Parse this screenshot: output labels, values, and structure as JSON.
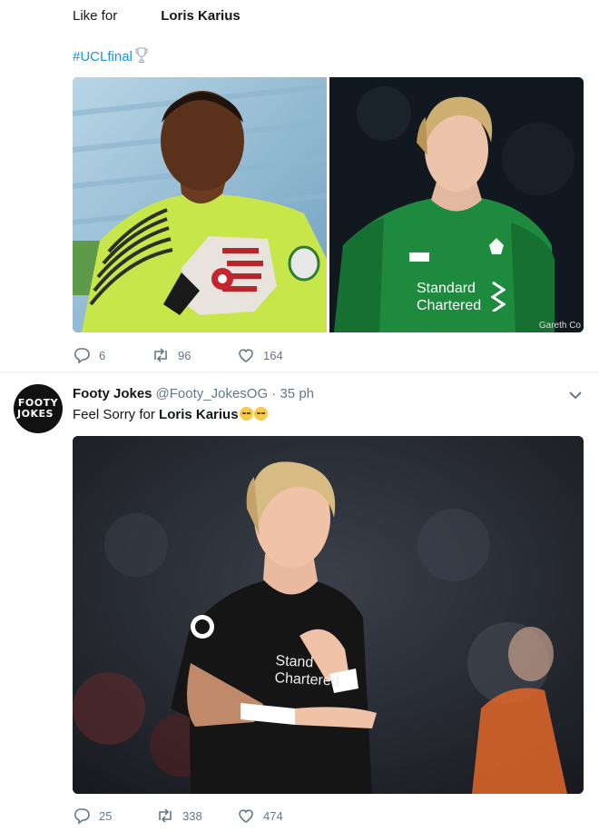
{
  "tweet1": {
    "text_prefix": "Like for",
    "text_name": "Loris Karius",
    "hashtag": "#UCLfinal",
    "media_left_label": "goalkeeper-green-jersey-photo",
    "media_right": {
      "sponsor_line1": "Standard",
      "sponsor_line2": "Chartered",
      "watermark": "Gareth Co"
    },
    "actions": {
      "replies": "6",
      "retweets": "96",
      "likes": "164"
    }
  },
  "tweet2": {
    "avatar_line1": "FOOTY",
    "avatar_line2": "JOKES",
    "display_name": "Footy Jokes",
    "handle": "@Footy_JokesOG · 35 ph",
    "text_prefix": "Feel Sorry for",
    "text_name": "Loris Karius",
    "media": {
      "sponsor_line1": "Stand",
      "sponsor_line2": "Chartered"
    },
    "actions": {
      "replies": "25",
      "retweets": "338",
      "likes": "474"
    }
  },
  "colors": {
    "link": "#1b95e0",
    "muted": "#657786",
    "text": "#14171a",
    "divider": "#e6ecf0"
  }
}
